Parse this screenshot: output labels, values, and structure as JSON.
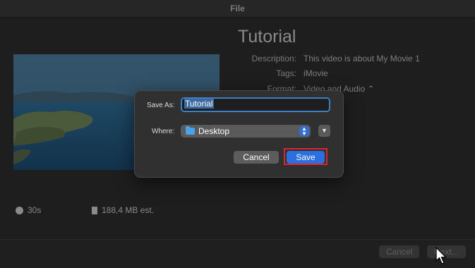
{
  "window": {
    "title": "File"
  },
  "sheet": {
    "title": "Tutorial",
    "fields": [
      {
        "key": "Description:",
        "value": "This video is about My Movie 1"
      },
      {
        "key": "Tags:",
        "value": "iMovie"
      },
      {
        "key": "Format:",
        "value": "Video and Audio ⌃"
      }
    ],
    "duration": "30s",
    "size": "188,4 MB est.",
    "cancel_label": "Cancel",
    "next_label": "Next..."
  },
  "dialog": {
    "save_as_label": "Save As:",
    "filename": "Tutorial",
    "where_label": "Where:",
    "where_value": "Desktop",
    "cancel_label": "Cancel",
    "save_label": "Save",
    "highlight_color": "#e0242b",
    "accent_color": "#2c6fe0"
  },
  "icons": [
    "clock-icon",
    "file-icon",
    "folder-icon",
    "updown-chevron-icon",
    "chevron-down-icon",
    "mouse-pointer-icon"
  ]
}
